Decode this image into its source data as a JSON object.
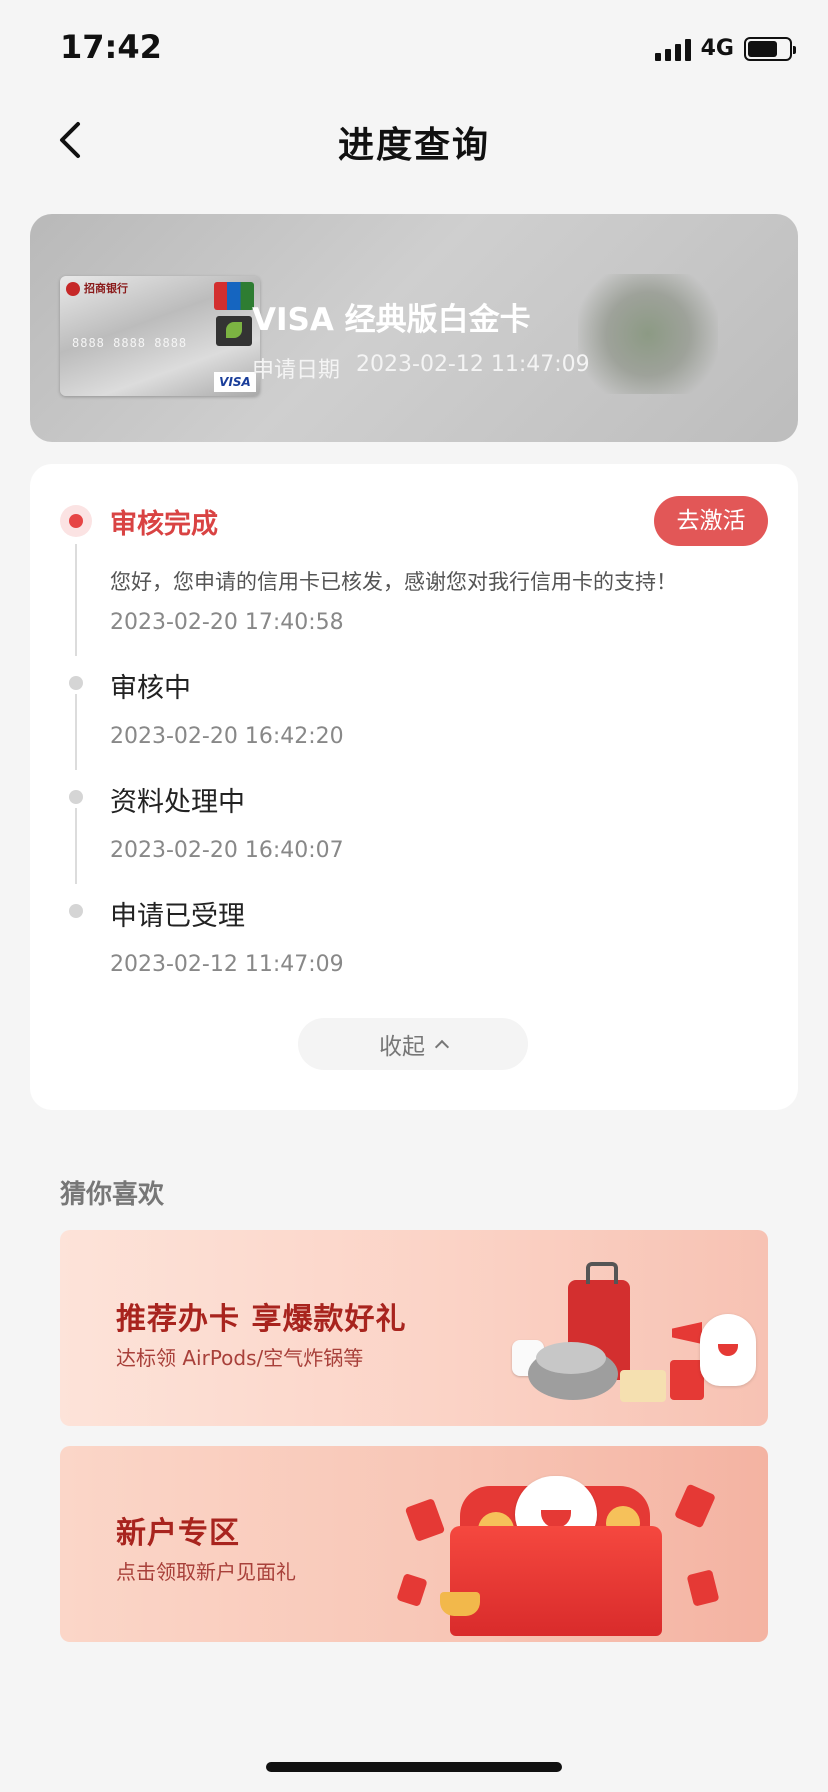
{
  "status_bar": {
    "time": "17:42",
    "network": "4G"
  },
  "nav": {
    "title": "进度查询"
  },
  "card": {
    "name": "VISA 经典版白金卡",
    "date_label": "申请日期",
    "date_value": "2023-02-12 11:47:09",
    "bank_name": "招商银行",
    "card_number": "8888 8888 8888",
    "brand": "VISA"
  },
  "progress": {
    "activate_label": "去激活",
    "collapse_label": "收起",
    "steps": [
      {
        "title": "审核完成",
        "desc": "您好，您申请的信用卡已核发，感谢您对我行信用卡的支持！",
        "time": "2023-02-20 17:40:58"
      },
      {
        "title": "审核中",
        "time": "2023-02-20 16:42:20"
      },
      {
        "title": "资料处理中",
        "time": "2023-02-20 16:40:07"
      },
      {
        "title": "申请已受理",
        "time": "2023-02-12 11:47:09"
      }
    ]
  },
  "recommend": {
    "section_title": "猜你喜欢",
    "promos": [
      {
        "title": "推荐办卡 享爆款好礼",
        "subtitle": "达标领 AirPods/空气炸锅等"
      },
      {
        "title": "新户专区",
        "subtitle": "点击领取新户见面礼"
      }
    ]
  },
  "colors": {
    "accent": "#e25757",
    "active_step": "#d94343",
    "promo_title": "#a8241e"
  }
}
